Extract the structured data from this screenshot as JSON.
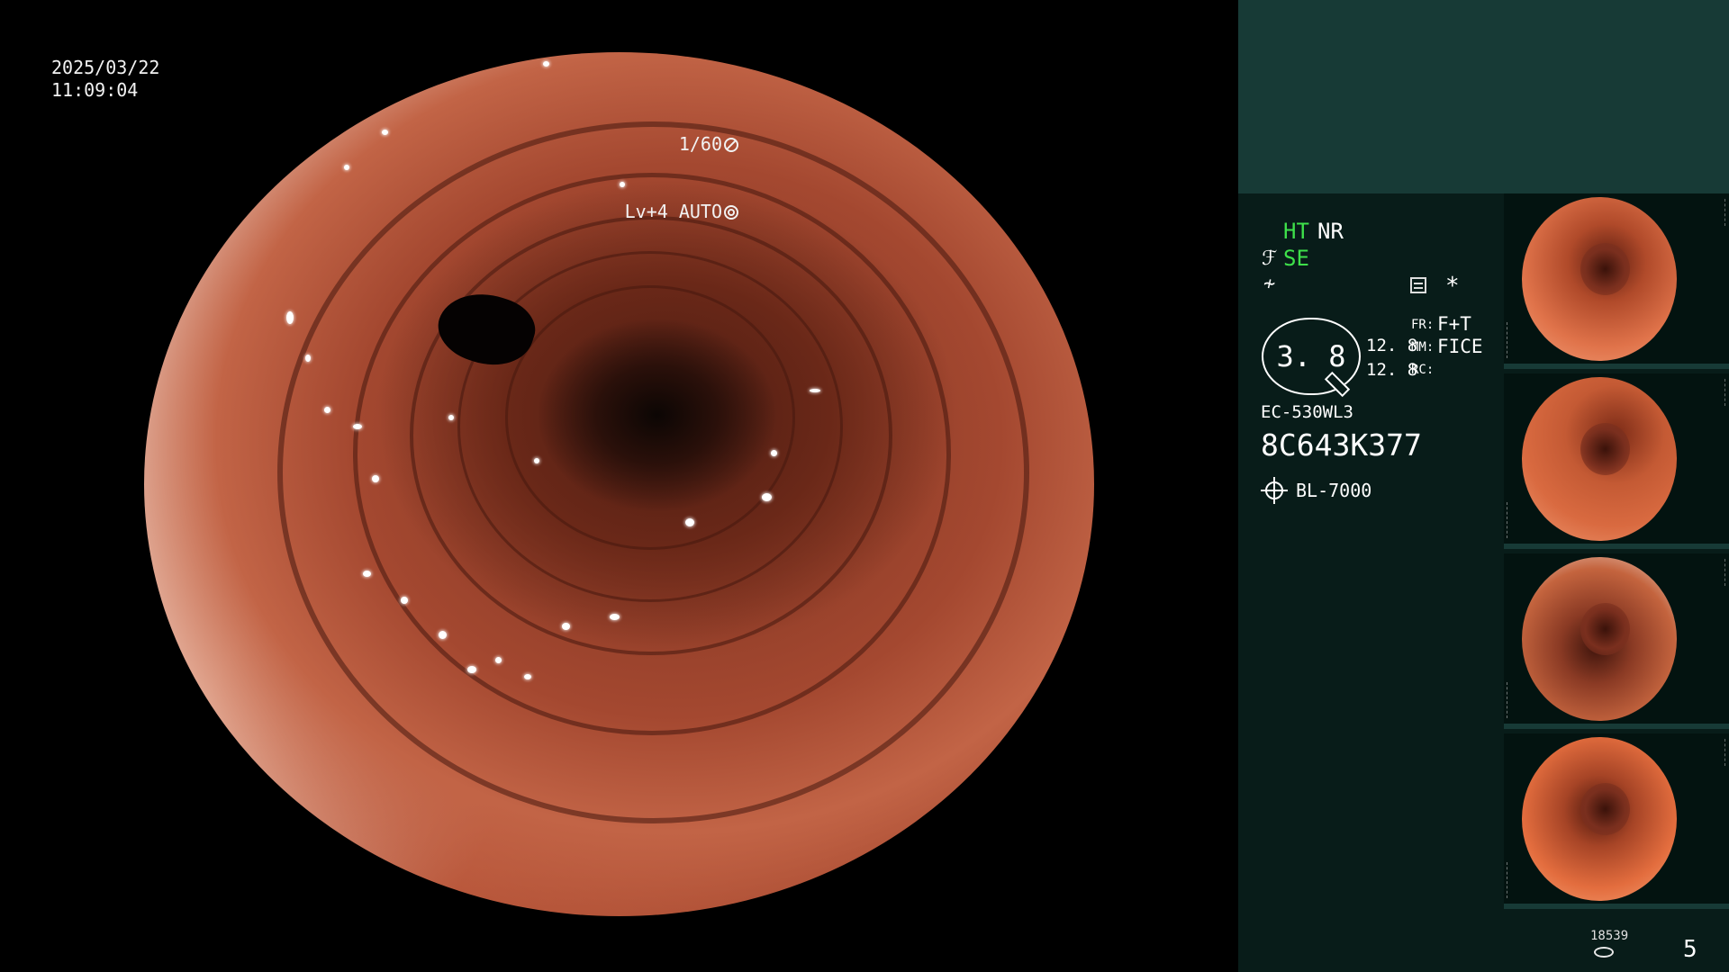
{
  "osd": {
    "date": "2025/03/22",
    "time": "11:09:04",
    "shutter": "1/60",
    "iris_level": "Lv+4 AUTO",
    "shutter_icon": "shutter-icon",
    "iris_icon": "iris-auto-icon"
  },
  "modes": {
    "ht": "HT",
    "nr": "NR",
    "se": "SE",
    "se_icon_glyph": "ℱ",
    "f_icon_glyph": "≁",
    "asterisk": "*"
  },
  "zoom": {
    "value": "3. 8",
    "value_1": "12. 8",
    "value_2": "12. 8",
    "fr_label": "FR:",
    "mm_label": "MM:",
    "rc_label": "RC:",
    "fr_value": "F+T",
    "mm_value": "FICE"
  },
  "scope": {
    "model": "EC-530WL3",
    "serial": "8C643K377",
    "light_source": "BL-7000"
  },
  "thumbnails": [
    {
      "label": "thumbnail-1",
      "tone": "#e0734a"
    },
    {
      "label": "thumbnail-2",
      "tone": "#d96a40"
    },
    {
      "label": "thumbnail-3",
      "tone": "#c4643e"
    },
    {
      "label": "thumbnail-4",
      "tone": "#e36d3e"
    }
  ],
  "footer": {
    "image_count": "18539",
    "page": "5"
  },
  "colors": {
    "panel_bg": "#081c19",
    "panel_top": "#173a36",
    "mode_active": "#3ee04a",
    "osd_text": "#f2f2f2"
  }
}
